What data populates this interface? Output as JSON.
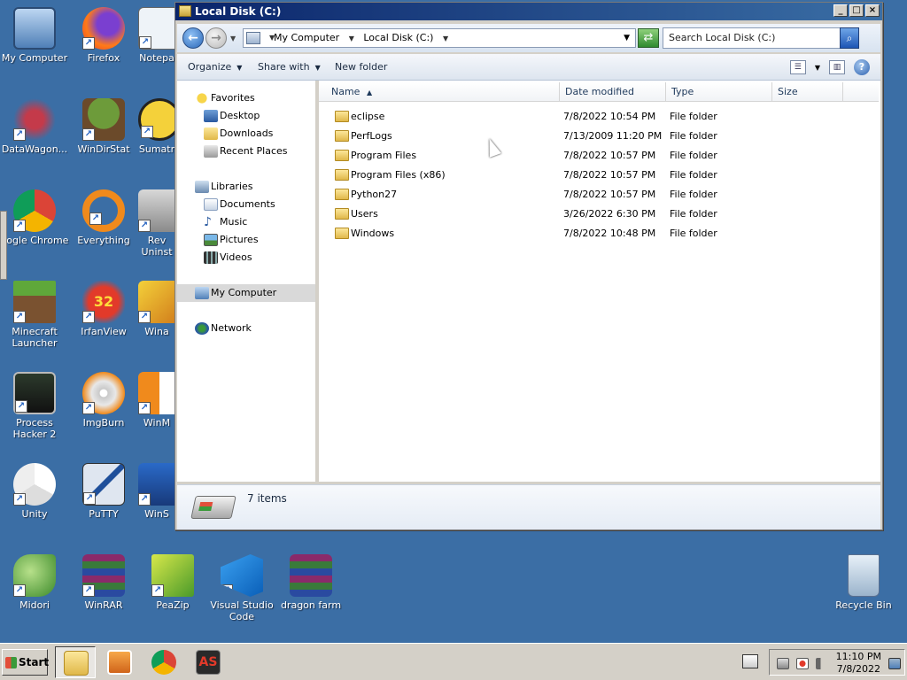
{
  "desktop": {
    "icons": [
      {
        "label": "My Computer"
      },
      {
        "label": "Firefox"
      },
      {
        "label": "Notepa"
      },
      {
        "label": "DataWagon..."
      },
      {
        "label": "WinDirStat"
      },
      {
        "label": "Sumatr"
      },
      {
        "label": "oogle Chrome"
      },
      {
        "label": "Everything"
      },
      {
        "label": "Rev Uninst"
      },
      {
        "label": "Minecraft Launcher"
      },
      {
        "label": "IrfanView"
      },
      {
        "label": "Wina"
      },
      {
        "label": "Process Hacker 2"
      },
      {
        "label": "ImgBurn"
      },
      {
        "label": "WinM"
      },
      {
        "label": "Unity"
      },
      {
        "label": "PuTTY"
      },
      {
        "label": "WinS"
      },
      {
        "label": "Midori"
      },
      {
        "label": "WinRAR"
      },
      {
        "label": "PeaZip"
      },
      {
        "label": "Visual Studio Code"
      },
      {
        "label": "dragon farm"
      },
      {
        "label": "Recycle Bin"
      }
    ],
    "irfanview_badge": "32"
  },
  "window": {
    "title": "Local Disk (C:)",
    "buttons": {
      "minimize": "_",
      "maximize": "□",
      "close": "×"
    },
    "address": {
      "crumbs": [
        "My Computer",
        "Local Disk (C:)"
      ],
      "separator": "▸"
    },
    "search_placeholder": "Search Local Disk (C:)",
    "toolbar": {
      "organize": "Organize",
      "share_with": "Share with",
      "new_folder": "New folder"
    },
    "nav": {
      "favorites": "Favorites",
      "desktop": "Desktop",
      "downloads": "Downloads",
      "recent_places": "Recent Places",
      "libraries": "Libraries",
      "documents": "Documents",
      "music": "Music",
      "pictures": "Pictures",
      "videos": "Videos",
      "my_computer": "My Computer",
      "network": "Network"
    },
    "columns": {
      "name": "Name",
      "date": "Date modified",
      "type": "Type",
      "size": "Size"
    },
    "files": [
      {
        "name": "eclipse",
        "date": "7/8/2022 10:54 PM",
        "type": "File folder"
      },
      {
        "name": "PerfLogs",
        "date": "7/13/2009 11:20 PM",
        "type": "File folder"
      },
      {
        "name": "Program Files",
        "date": "7/8/2022 10:57 PM",
        "type": "File folder"
      },
      {
        "name": "Program Files (x86)",
        "date": "7/8/2022 10:57 PM",
        "type": "File folder"
      },
      {
        "name": "Python27",
        "date": "7/8/2022 10:57 PM",
        "type": "File folder"
      },
      {
        "name": "Users",
        "date": "3/26/2022 6:30 PM",
        "type": "File folder"
      },
      {
        "name": "Windows",
        "date": "7/8/2022 10:48 PM",
        "type": "File folder"
      }
    ],
    "status": {
      "item_count": "7 items"
    }
  },
  "taskbar": {
    "start": "Start",
    "clock_time": "11:10 PM",
    "clock_date": "7/8/2022",
    "as_label": "AS"
  },
  "colors": {
    "desktop_bg": "#3b6ea5",
    "title_bar": "#0a246a",
    "selection": "#d9d9d9"
  }
}
